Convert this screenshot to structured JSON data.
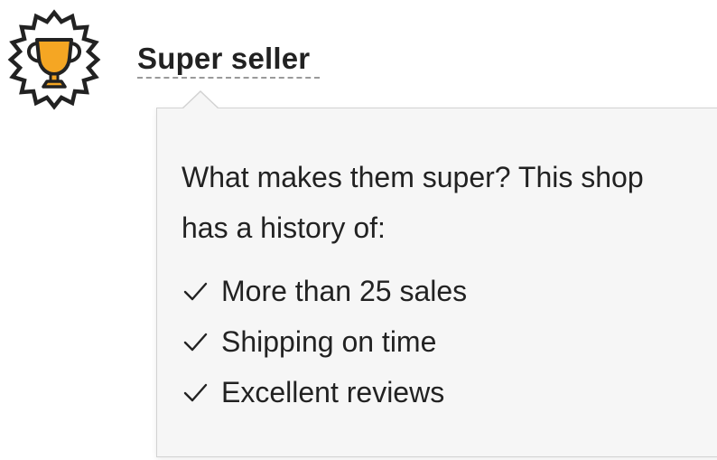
{
  "badge": {
    "label": "Super seller",
    "icon": "trophy-icon",
    "colors": {
      "trophy": "#f5a623",
      "outline": "#222222"
    }
  },
  "popover": {
    "intro_line1": "What makes them super? This shop",
    "intro_line2": "has a history of:",
    "items": [
      {
        "icon": "check-icon",
        "label": "More than 25 sales"
      },
      {
        "icon": "check-icon",
        "label": "Shipping on time"
      },
      {
        "icon": "check-icon",
        "label": "Excellent reviews"
      }
    ],
    "colors": {
      "background": "#f6f6f6",
      "border": "#d2d2d2"
    }
  }
}
